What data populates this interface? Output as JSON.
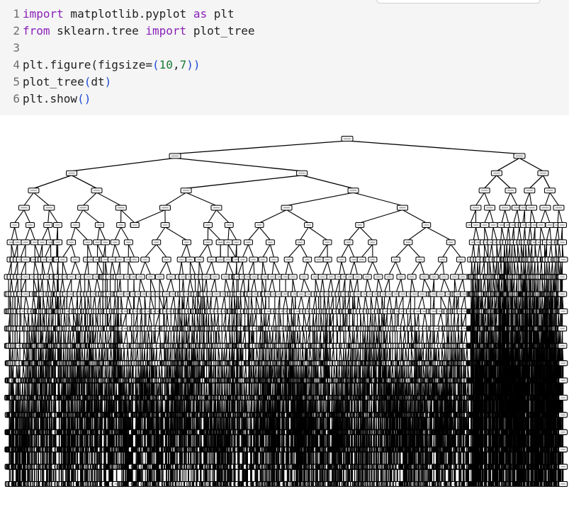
{
  "notebook": {
    "code_lines": [
      {
        "no": "1",
        "parts": [
          {
            "t": "import",
            "c": "kw"
          },
          {
            "t": " matplotlib.pyplot ",
            "c": ""
          },
          {
            "t": "as",
            "c": "kw"
          },
          {
            "t": " plt",
            "c": ""
          }
        ]
      },
      {
        "no": "2",
        "parts": [
          {
            "t": "from",
            "c": "kw"
          },
          {
            "t": " sklearn.tree ",
            "c": ""
          },
          {
            "t": "import",
            "c": "kw"
          },
          {
            "t": " plot_tree",
            "c": ""
          }
        ]
      },
      {
        "no": "3",
        "parts": []
      },
      {
        "no": "4",
        "parts": [
          {
            "t": "plt.figure(figsize=",
            "c": ""
          },
          {
            "t": "(",
            "c": "paren"
          },
          {
            "t": "10",
            "c": "num"
          },
          {
            "t": ",",
            "c": ""
          },
          {
            "t": "7",
            "c": "num"
          },
          {
            "t": "))",
            "c": "paren"
          }
        ]
      },
      {
        "no": "5",
        "parts": [
          {
            "t": "plot_tree",
            "c": ""
          },
          {
            "t": "(",
            "c": "paren"
          },
          {
            "t": "dt",
            "c": ""
          },
          {
            "t": ")",
            "c": "paren"
          }
        ]
      },
      {
        "no": "6",
        "parts": [
          {
            "t": "plt.show",
            "c": ""
          },
          {
            "t": "()",
            "c": "paren"
          }
        ]
      }
    ]
  },
  "colors": {
    "keyword": "#8a20b8",
    "number": "#1a7a38",
    "paren": "#1f4bd6",
    "cell_bg": "#f5f5f5",
    "node_fill": "#f0f0f0",
    "edge": "#000000"
  }
}
